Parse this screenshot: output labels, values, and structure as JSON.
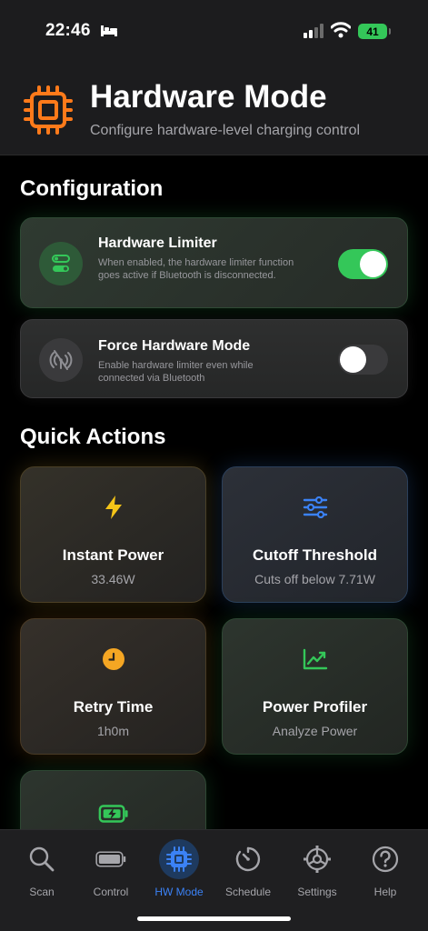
{
  "status_bar": {
    "time": "22:46",
    "battery": "41"
  },
  "header": {
    "title": "Hardware Mode",
    "subtitle": "Configure hardware-level charging control"
  },
  "configuration": {
    "title": "Configuration",
    "items": [
      {
        "title": "Hardware Limiter",
        "description": "When enabled, the hardware limiter function goes active if Bluetooth is disconnected.",
        "enabled": true
      },
      {
        "title": "Force Hardware Mode",
        "description": "Enable hardware limiter even while connected via Bluetooth",
        "enabled": false
      }
    ]
  },
  "quick_actions": {
    "title": "Quick Actions",
    "cards": [
      {
        "title": "Instant Power",
        "subtitle": "33.46W",
        "icon": "bolt-icon",
        "color": "#f5c518"
      },
      {
        "title": "Cutoff Threshold",
        "subtitle": "Cuts off below 7.71W",
        "icon": "sliders-icon",
        "color": "#3b82f6"
      },
      {
        "title": "Retry Time",
        "subtitle": "1h0m",
        "icon": "clock-icon",
        "color": "#f5a623"
      },
      {
        "title": "Power Profiler",
        "subtitle": "Analyze Power",
        "icon": "chart-icon",
        "color": "#34c759"
      },
      {
        "title": "",
        "subtitle": "",
        "icon": "battery-charging-icon",
        "color": "#34c759"
      }
    ]
  },
  "tab_bar": {
    "tabs": [
      {
        "label": "Scan",
        "icon": "search-icon"
      },
      {
        "label": "Control",
        "icon": "battery-icon"
      },
      {
        "label": "HW Mode",
        "icon": "chip-icon",
        "active": true
      },
      {
        "label": "Schedule",
        "icon": "timer-icon"
      },
      {
        "label": "Settings",
        "icon": "gear-icon"
      },
      {
        "label": "Help",
        "icon": "help-icon"
      }
    ]
  },
  "colors": {
    "accent": "#3b82f6",
    "toggle_on": "#34c759",
    "chip_orange": "#ff7a1a"
  }
}
